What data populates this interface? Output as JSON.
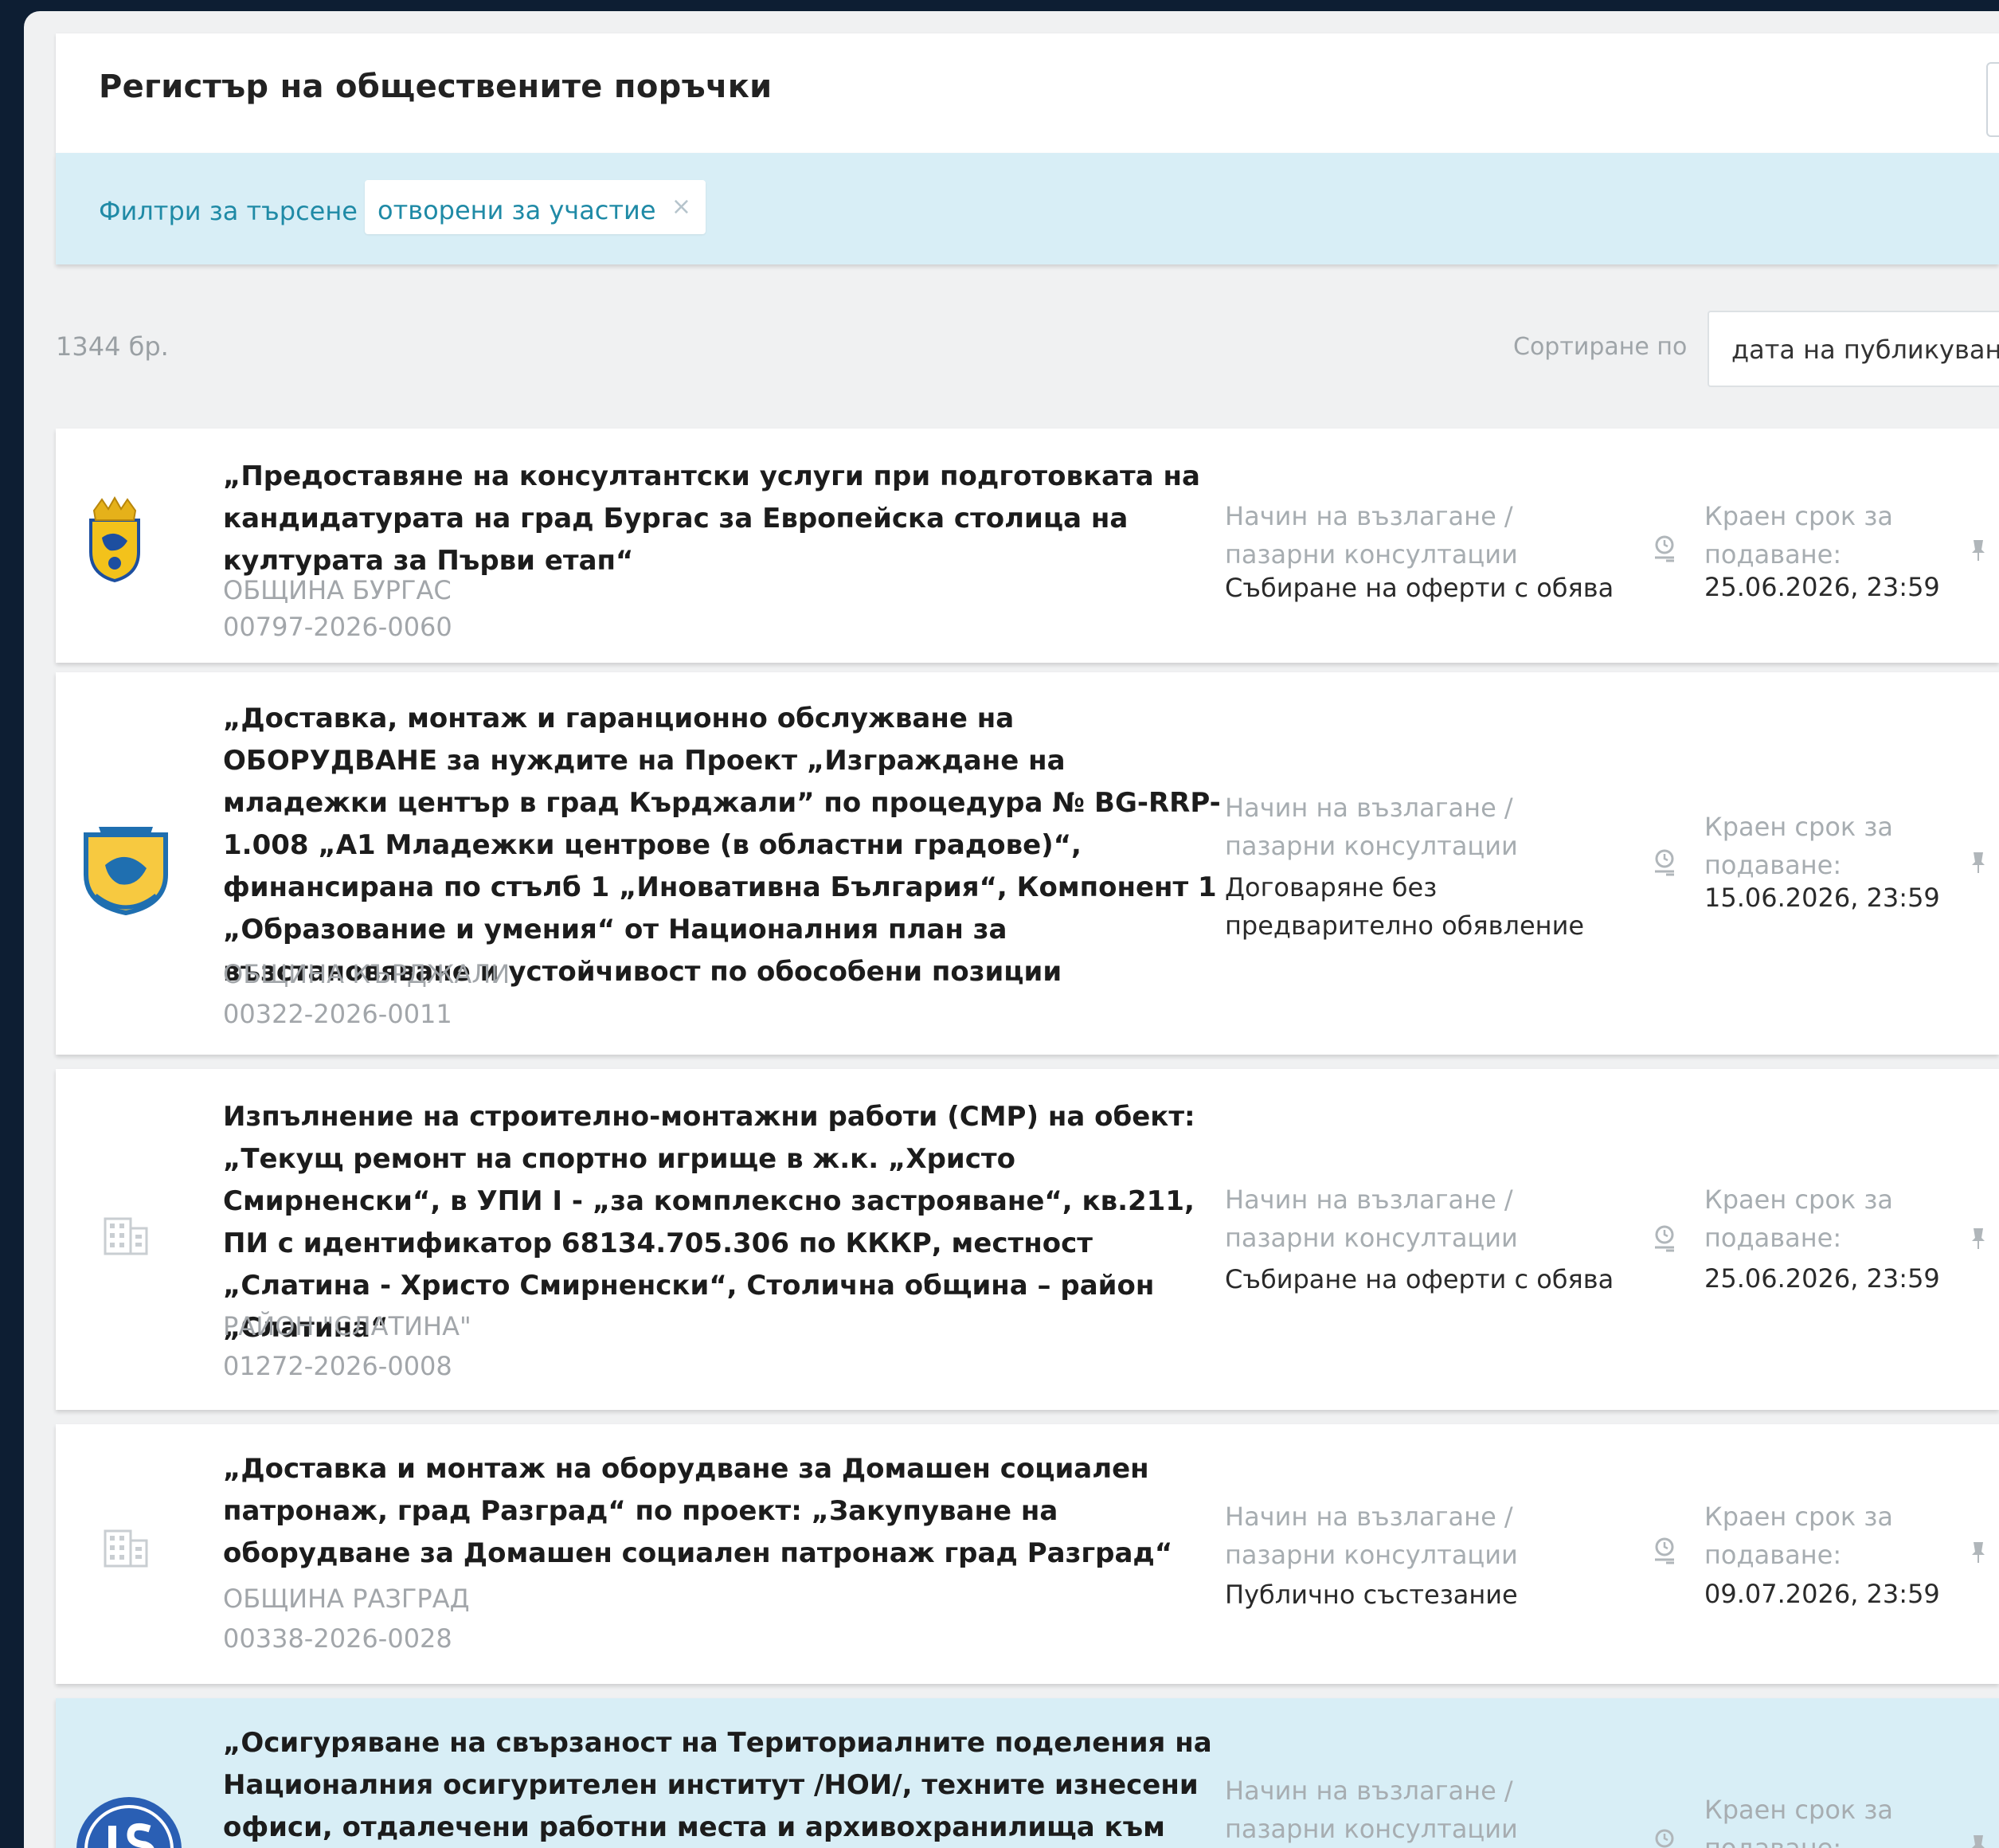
{
  "header": {
    "title": "Регистър на обществените поръчки"
  },
  "filters": {
    "label": "Филтри за търсене",
    "chip_label": "отворени за участие",
    "chip_close": "×"
  },
  "results": {
    "count": "1344 бр.",
    "sort_label": "Сортиране по",
    "sort_value": "дата на публикуване"
  },
  "labels": {
    "method": "Начин на възлагане / пазарни консултации",
    "deadline": "Краен срок за подаване:"
  },
  "cards": [
    {
      "title": "„Предоставяне на консултантски услуги при подготовката на кандидатурата на град Бургас за Европейска столица на културата за Първи етап“",
      "org": "ОБЩИНА БУРГАС",
      "code": "00797-2026-0060",
      "method": "Събиране на оферти с обява",
      "deadline": "25.06.2026, 23:59",
      "logo": "burgas-crest"
    },
    {
      "title": "„Доставка, монтаж и гаранционно обслужване на ОБОРУДВАНЕ за нуждите на Проект „Изграждане на младежки център в град Кърджали” по процедура № BG-RRP-1.008 „А1 Младежки центрове (в областни градове)“, финансирана по стълб 1 „Иновативна България“, Компонент 1 „Образование и умения“ от Националния план за възстановяване и устойчивост по обособени позиции",
      "org": "ОБЩИНА КЪРДЖАЛИ",
      "code": "00322-2026-0011",
      "method": "Договаряне без предварително обявление",
      "deadline": "15.06.2026, 23:59",
      "logo": "kardzhali-crest"
    },
    {
      "title": "Изпълнение на строително-монтажни работи (СМР) на обект: „Текущ ремонт на спортно игрище в ж.к. „Христо Смирненски“, в УПИ I - „за комплексно застрояване“, кв.211, ПИ с идентификатор 68134.705.306 по КККР, местност „Слатина - Христо Смирненски“, Столична община – район „Слатина“",
      "org": "РАЙОН \"СЛАТИНА\"",
      "code": "01272-2026-0008",
      "method": "Събиране на оферти с обява",
      "deadline": "25.06.2026, 23:59",
      "logo": "building-icon"
    },
    {
      "title": "„Доставка и монтаж на оборудване за Домашен социален патронаж, град Разград“ по проект: „Закупуване на оборудване за Домашен социален патронаж град Разград“",
      "org": "ОБЩИНА РАЗГРАД",
      "code": "00338-2026-0028",
      "method": "Публично състезание",
      "deadline": "09.07.2026, 23:59",
      "logo": "building-icon"
    },
    {
      "title": "„Осигуряване на свързаност на Териториалните поделения на Националния осигурителен институт /НОИ/, техните изнесени офиси, отдалечени работни места и архивохранилища към Централното",
      "logo": "noi-logo"
    }
  ]
}
